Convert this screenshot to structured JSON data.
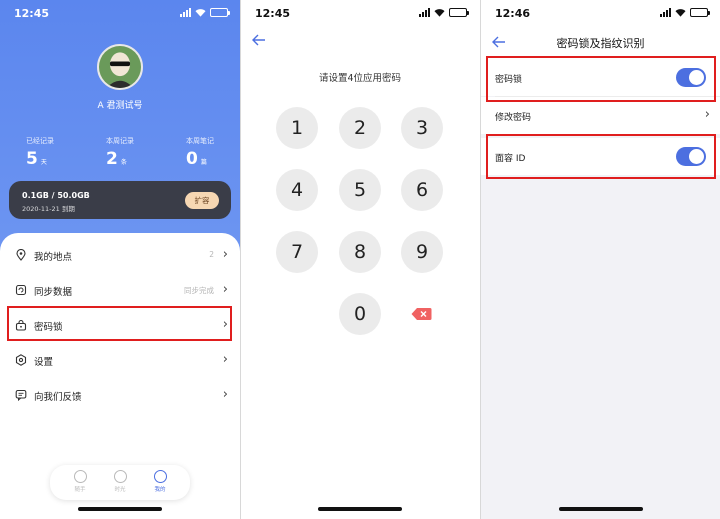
{
  "colors": {
    "accent": "#4c6fe0",
    "highlight": "#e01e1e",
    "storage_button": "#f6d7b3"
  },
  "profile": {
    "status_time": "12:45",
    "username": "A 君测试号",
    "stats": [
      {
        "label": "已经记录",
        "value": "5",
        "unit": "天"
      },
      {
        "label": "本周记录",
        "value": "2",
        "unit": "条"
      },
      {
        "label": "本周笔记",
        "value": "0",
        "unit": "篇"
      }
    ],
    "storage": {
      "size": "0.1GB / 50.0GB",
      "expiry": "2020-11-21 到期",
      "button": "扩容"
    },
    "menu": [
      {
        "label": "我的地点",
        "value": "2",
        "icon": "location-pin-icon"
      },
      {
        "label": "同步数据",
        "value": "同步完成",
        "icon": "sync-icon"
      },
      {
        "label": "密码锁",
        "value": "",
        "icon": "lock-icon"
      },
      {
        "label": "设置",
        "value": "",
        "icon": "gear-icon"
      },
      {
        "label": "向我们反馈",
        "value": "",
        "icon": "feedback-icon"
      }
    ],
    "tabs": [
      {
        "label": "随手",
        "icon": "smile-icon"
      },
      {
        "label": "时光",
        "icon": "globe-icon"
      },
      {
        "label": "我的",
        "icon": "profile-icon"
      }
    ]
  },
  "passcode": {
    "status_time": "12:45",
    "prompt": "请设置4位应用密码",
    "keys": [
      "1",
      "2",
      "3",
      "4",
      "5",
      "6",
      "7",
      "8",
      "9",
      "0"
    ]
  },
  "lock_settings": {
    "status_time": "12:46",
    "title": "密码锁及指纹识别",
    "rows": [
      {
        "label": "密码锁",
        "toggle": true
      },
      {
        "label": "修改密码",
        "toggle": null
      },
      {
        "label": "面容 ID",
        "toggle": true
      }
    ]
  }
}
